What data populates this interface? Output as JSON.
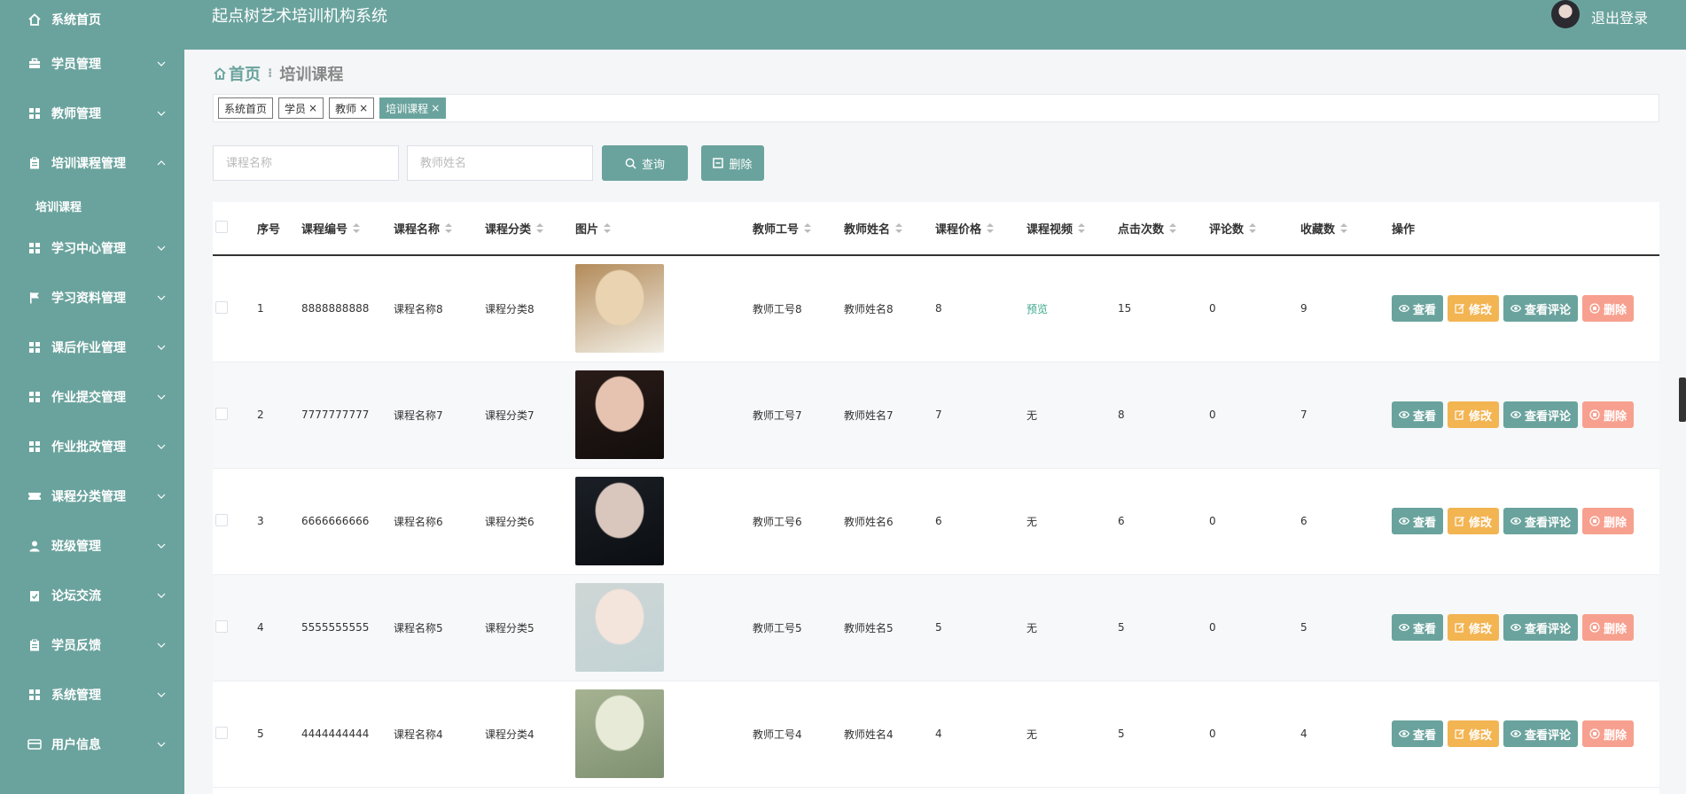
{
  "header": {
    "title": "起点树艺术培训机构系统",
    "logout": "退出登录"
  },
  "sidebar": {
    "items": [
      {
        "label": "系统首页",
        "icon": "home-icon",
        "chevron": false
      },
      {
        "label": "学员管理",
        "icon": "briefcase-icon",
        "chevron": true
      },
      {
        "label": "教师管理",
        "icon": "grid-icon",
        "chevron": true
      },
      {
        "label": "培训课程管理",
        "icon": "clipboard-icon",
        "chevron": true,
        "open": true,
        "sub": [
          "培训课程"
        ]
      },
      {
        "label": "学习中心管理",
        "icon": "grid-icon",
        "chevron": true
      },
      {
        "label": "学习资料管理",
        "icon": "flag-icon",
        "chevron": true
      },
      {
        "label": "课后作业管理",
        "icon": "grid-icon",
        "chevron": true
      },
      {
        "label": "作业提交管理",
        "icon": "grid-icon",
        "chevron": true
      },
      {
        "label": "作业批改管理",
        "icon": "grid-icon",
        "chevron": true
      },
      {
        "label": "课程分类管理",
        "icon": "ticket-icon",
        "chevron": true
      },
      {
        "label": "班级管理",
        "icon": "user-icon",
        "chevron": true
      },
      {
        "label": "论坛交流",
        "icon": "clipboard-check-icon",
        "chevron": true
      },
      {
        "label": "学员反馈",
        "icon": "clipboard-icon",
        "chevron": true
      },
      {
        "label": "系统管理",
        "icon": "grid-icon",
        "chevron": true
      },
      {
        "label": "用户信息",
        "icon": "card-icon",
        "chevron": true
      }
    ]
  },
  "breadcrumb": {
    "home": "首页",
    "sep": "⁝",
    "current": "培训课程"
  },
  "tags": [
    {
      "label": "系统首页",
      "closable": false,
      "active": false
    },
    {
      "label": "学员",
      "closable": true,
      "active": false
    },
    {
      "label": "教师",
      "closable": true,
      "active": false
    },
    {
      "label": "培训课程",
      "closable": true,
      "active": true
    }
  ],
  "search": {
    "course_name_placeholder": "课程名称",
    "teacher_name_placeholder": "教师姓名",
    "query_label": "查询",
    "delete_label": "删除"
  },
  "table": {
    "columns": [
      "序号",
      "课程编号",
      "课程名称",
      "课程分类",
      "图片",
      "教师工号",
      "教师姓名",
      "课程价格",
      "课程视频",
      "点击次数",
      "评论数",
      "收藏数",
      "操作"
    ],
    "sortable": [
      false,
      true,
      true,
      true,
      true,
      true,
      true,
      true,
      true,
      true,
      true,
      true,
      false
    ],
    "rows": [
      {
        "no": "1",
        "code": "8888888888",
        "name": "课程名称8",
        "category": "课程分类8",
        "teacher_id": "教师工号8",
        "teacher_name": "教师姓名8",
        "price": "8",
        "video": "预览",
        "video_link": true,
        "clicks": "15",
        "comments": "0",
        "favorites": "9",
        "image_colors": [
          "#e9d3b0",
          "#b38b5a",
          "#f2efe6"
        ]
      },
      {
        "no": "2",
        "code": "7777777777",
        "name": "课程名称7",
        "category": "课程分类7",
        "teacher_id": "教师工号7",
        "teacher_name": "教师姓名7",
        "price": "7",
        "video": "无",
        "video_link": false,
        "clicks": "8",
        "comments": "0",
        "favorites": "7",
        "image_colors": [
          "#e6c3b0",
          "#2a1c18",
          "#120d0c"
        ]
      },
      {
        "no": "3",
        "code": "6666666666",
        "name": "课程名称6",
        "category": "课程分类6",
        "teacher_id": "教师工号6",
        "teacher_name": "教师姓名6",
        "price": "6",
        "video": "无",
        "video_link": false,
        "clicks": "6",
        "comments": "0",
        "favorites": "6",
        "image_colors": [
          "#d9c6bd",
          "#1b2026",
          "#0b0e12"
        ]
      },
      {
        "no": "4",
        "code": "5555555555",
        "name": "课程名称5",
        "category": "课程分类5",
        "teacher_id": "教师工号5",
        "teacher_name": "教师姓名5",
        "price": "5",
        "video": "无",
        "video_link": false,
        "clicks": "5",
        "comments": "0",
        "favorites": "5",
        "image_colors": [
          "#f3e4dc",
          "#cfd6d5",
          "#c2d3d5"
        ]
      },
      {
        "no": "5",
        "code": "4444444444",
        "name": "课程名称4",
        "category": "课程分类4",
        "teacher_id": "教师工号4",
        "teacher_name": "教师姓名4",
        "price": "4",
        "video": "无",
        "video_link": false,
        "clicks": "5",
        "comments": "0",
        "favorites": "4",
        "image_colors": [
          "#e6ead7",
          "#a6b393",
          "#7e9070"
        ]
      }
    ],
    "actions": {
      "view": "查看",
      "edit": "修改",
      "comment": "查看评论",
      "delete": "删除"
    }
  },
  "colors": {
    "primary": "#6aa39d",
    "edit": "#f3b452",
    "delete": "#f7a08f",
    "link": "#3ca88e"
  }
}
